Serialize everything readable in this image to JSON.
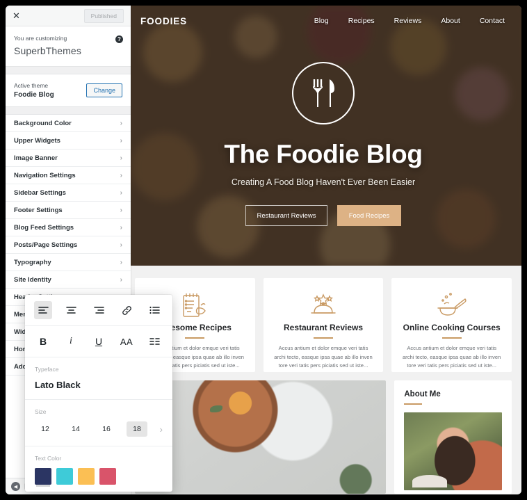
{
  "customizer": {
    "close_icon": "close-icon",
    "published_label": "Published",
    "customizing_eyebrow": "You are customizing",
    "site_name": "SuperbThemes",
    "help_icon": "help-icon",
    "active_theme_label": "Active theme",
    "active_theme_name": "Foodie Blog",
    "change_label": "Change",
    "panels": [
      {
        "label": "Background Color"
      },
      {
        "label": "Upper Widgets"
      },
      {
        "label": "Image Banner"
      },
      {
        "label": "Navigation Settings"
      },
      {
        "label": "Sidebar Settings"
      },
      {
        "label": "Footer Settings"
      },
      {
        "label": "Blog Feed Settings"
      },
      {
        "label": "Posts/Page Settings"
      },
      {
        "label": "Typography"
      },
      {
        "label": "Site Identity"
      },
      {
        "label": "Header Settings"
      },
      {
        "label": "Menus"
      },
      {
        "label": "Widgets"
      },
      {
        "label": "Homepage Settings"
      },
      {
        "label": "Additional CSS"
      }
    ],
    "collapse_icon": "collapse-icon"
  },
  "typography_popup": {
    "align_row": [
      {
        "name": "align-left-icon",
        "active": true
      },
      {
        "name": "align-center-icon",
        "active": false
      },
      {
        "name": "align-right-icon",
        "active": false
      },
      {
        "name": "link-icon",
        "active": false
      },
      {
        "name": "bulleted-list-icon",
        "active": false
      }
    ],
    "format_row": [
      {
        "name": "bold-icon",
        "label": "B"
      },
      {
        "name": "italic-icon",
        "label": "i"
      },
      {
        "name": "underline-icon",
        "label": "U"
      },
      {
        "name": "font-size-icon",
        "label": "AA"
      },
      {
        "name": "justify-icon",
        "label": ""
      }
    ],
    "typeface_label": "Typeface",
    "typeface_value": "Lato Black",
    "size_label": "Size",
    "sizes": [
      "12",
      "14",
      "16",
      "18"
    ],
    "size_selected": "18",
    "size_next_icon": "chevron-right-icon",
    "text_color_label": "Text Color",
    "colors": [
      "#2b3563",
      "#3ecbd8",
      "#fbbf54",
      "#d9546a"
    ],
    "color_selected_index": 0
  },
  "site": {
    "logo": "FOODIES",
    "nav": [
      {
        "label": "Blog"
      },
      {
        "label": "Recipes"
      },
      {
        "label": "Reviews"
      },
      {
        "label": "About"
      },
      {
        "label": "Contact"
      }
    ],
    "hero": {
      "badge_icon": "fork-knife-circle-icon",
      "title": "The Foodie Blog",
      "subtitle": "Creating A Food Blog Haven't Ever Been Easier",
      "btn_secondary": "Restaurant Reviews",
      "btn_primary": "Food Recipes",
      "primary_color": "#ddb285"
    },
    "cards": [
      {
        "icon": "recipe-notepad-icon",
        "title": "Awesome Recipes",
        "text": "Accus antium et dolor emque veri tatis archi tecto, easque ipsa quae ab illo inven tore veri tatis pers piciatis sed ut iste..."
      },
      {
        "icon": "cloche-stars-icon",
        "title": "Restaurant Reviews",
        "text": "Accus antium et dolor emque veri tatis archi tecto, easque ipsa quae ab illo inven tore veri tatis pers piciatis sed ut iste..."
      },
      {
        "icon": "mixing-bowl-icon",
        "title": "Online Cooking Courses",
        "text": "Accus antium et dolor emque veri tatis archi tecto, easque ipsa quae ab illo inven tore veri tatis pers piciatis sed ut iste..."
      }
    ],
    "about": {
      "title": "About Me",
      "photo_icon": "portrait-photo"
    },
    "accent_color": "#c99a63"
  }
}
